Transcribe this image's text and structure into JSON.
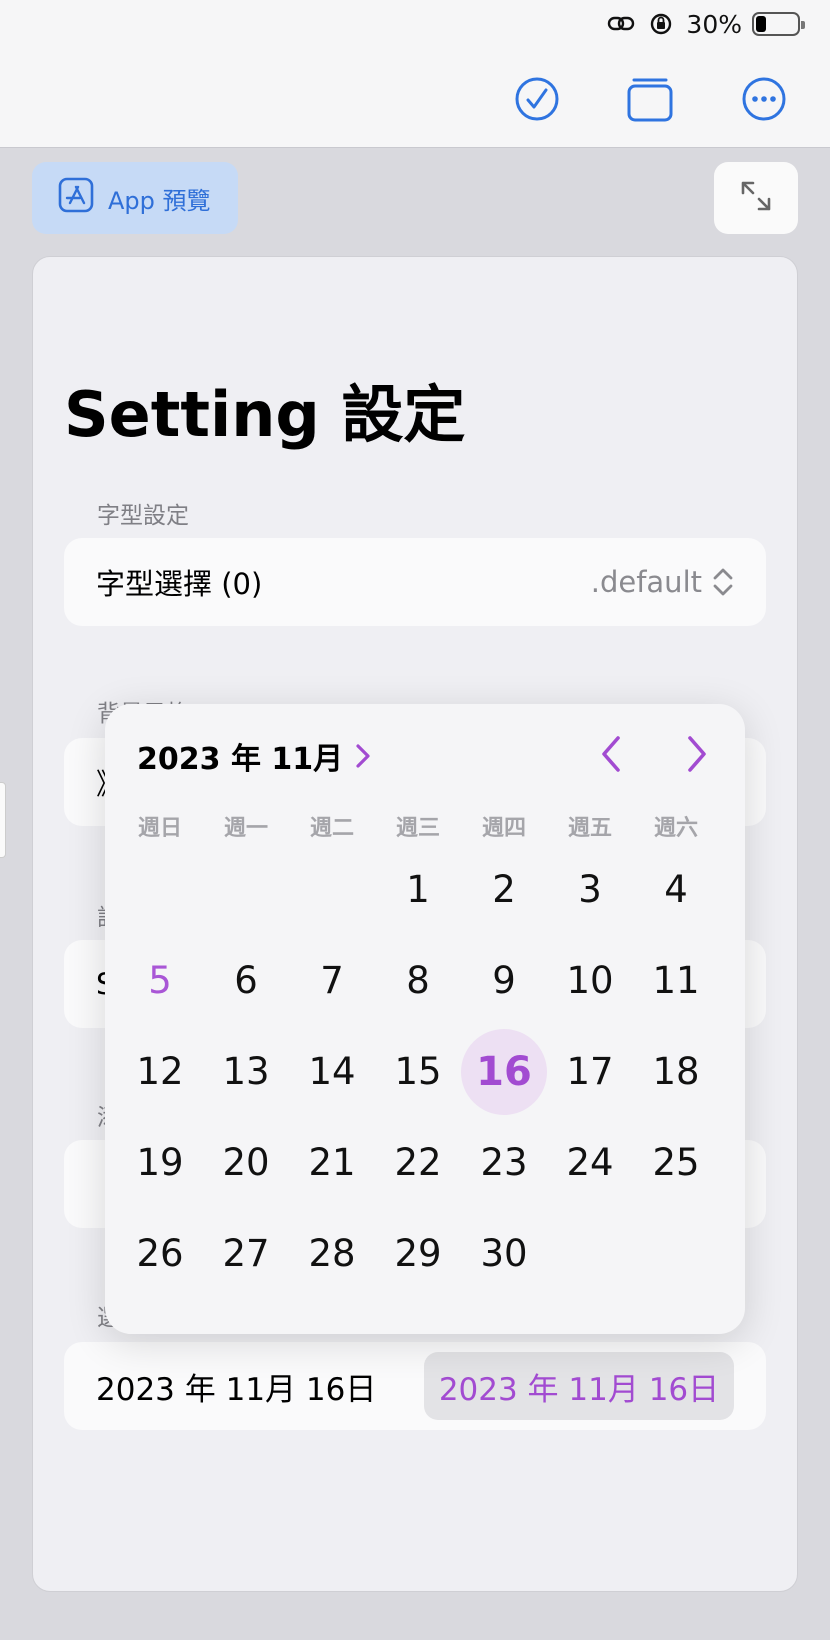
{
  "status": {
    "battery": "30%"
  },
  "toolbar": {
    "icons": [
      "checkmark-circle-icon",
      "stack-icon",
      "more-circle-icon"
    ],
    "accent": "#2f74e0"
  },
  "preview_chip": {
    "label": "App 預覽",
    "icon": "app-store-icon"
  },
  "page": {
    "title": "Setting 設定"
  },
  "sections": {
    "font": {
      "label": "字型設定",
      "row_label": "字型選擇 (0)",
      "row_value": ".default"
    },
    "background_label_partial": "背景風格",
    "hidden_row_initial": "》",
    "hidden_label_2": "設",
    "hidden_row_initial_2": "S",
    "hidden_label_3": "添",
    "hidden_label_4": "選"
  },
  "calendar": {
    "month_title": "2023 年 11月",
    "weekdays": [
      "週日",
      "週一",
      "週二",
      "週三",
      "週四",
      "週五",
      "週六"
    ],
    "days": [
      "",
      "",
      "",
      "1",
      "2",
      "3",
      "4",
      "5",
      "6",
      "7",
      "8",
      "9",
      "10",
      "11",
      "12",
      "13",
      "14",
      "15",
      "16",
      "17",
      "18",
      "19",
      "20",
      "21",
      "22",
      "23",
      "24",
      "25",
      "26",
      "27",
      "28",
      "29",
      "30"
    ],
    "selected_day": "16",
    "highlight_day": "5",
    "accent": "#a24bd1"
  },
  "date_row": {
    "label": "2023 年 11月 16日",
    "value": "2023 年 11月 16日"
  }
}
